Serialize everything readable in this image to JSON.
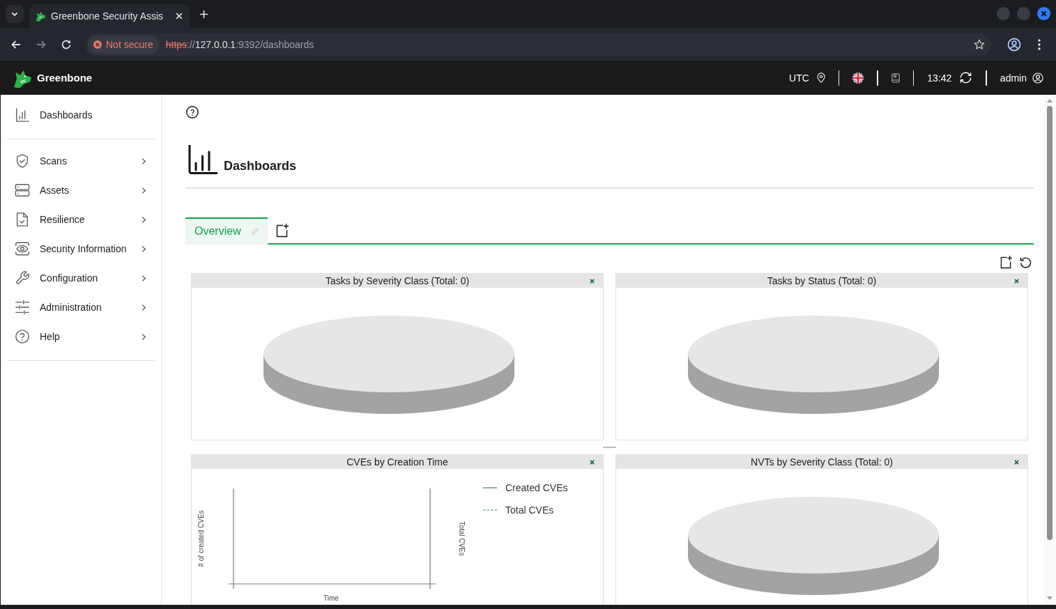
{
  "browser": {
    "tab": {
      "title": "Greenbone Security Assis",
      "selected": true
    },
    "back": {
      "disabled": false
    },
    "forward": {
      "disabled": true
    },
    "security_chip": "Not secure",
    "url": {
      "scheme": "https",
      "separator": "://",
      "host": "127.0.0.1",
      "path": ":9392/dashboards"
    }
  },
  "header": {
    "brand": "Greenbone",
    "timezone": "UTC",
    "time": "13:42",
    "user": "admin"
  },
  "sidebar": {
    "sections": [
      {
        "items": [
          {
            "label": "Dashboards",
            "kind": "link"
          }
        ]
      },
      {
        "items": [
          {
            "label": "Scans",
            "kind": "menu",
            "expanded": false
          },
          {
            "label": "Assets",
            "kind": "menu",
            "expanded": false
          },
          {
            "label": "Resilience",
            "kind": "menu",
            "expanded": false
          },
          {
            "label": "Security Information",
            "kind": "menu",
            "expanded": false
          },
          {
            "label": "Configuration",
            "kind": "menu",
            "expanded": false
          },
          {
            "label": "Administration",
            "kind": "menu",
            "expanded": false
          },
          {
            "label": "Help",
            "kind": "menu",
            "expanded": false
          }
        ]
      }
    ]
  },
  "page": {
    "title": "Dashboards"
  },
  "tabs": [
    {
      "label": "Overview",
      "selected": true
    }
  ],
  "panels": [
    {
      "title": "Tasks by Severity Class (Total: 0)",
      "kind": "pie"
    },
    {
      "title": "Tasks by Status (Total: 0)",
      "kind": "pie"
    },
    {
      "title": "CVEs by Creation Time",
      "kind": "line",
      "y_label": "# of created CVEs",
      "y2_label": "Total CVEs",
      "x_label": "Time",
      "legend": [
        {
          "label": "Created CVEs",
          "kind": "solid"
        },
        {
          "label": "Total CVEs",
          "kind": "dashed"
        }
      ]
    },
    {
      "title": "NVTs by Severity Class (Total: 0)",
      "kind": "pie"
    }
  ]
}
